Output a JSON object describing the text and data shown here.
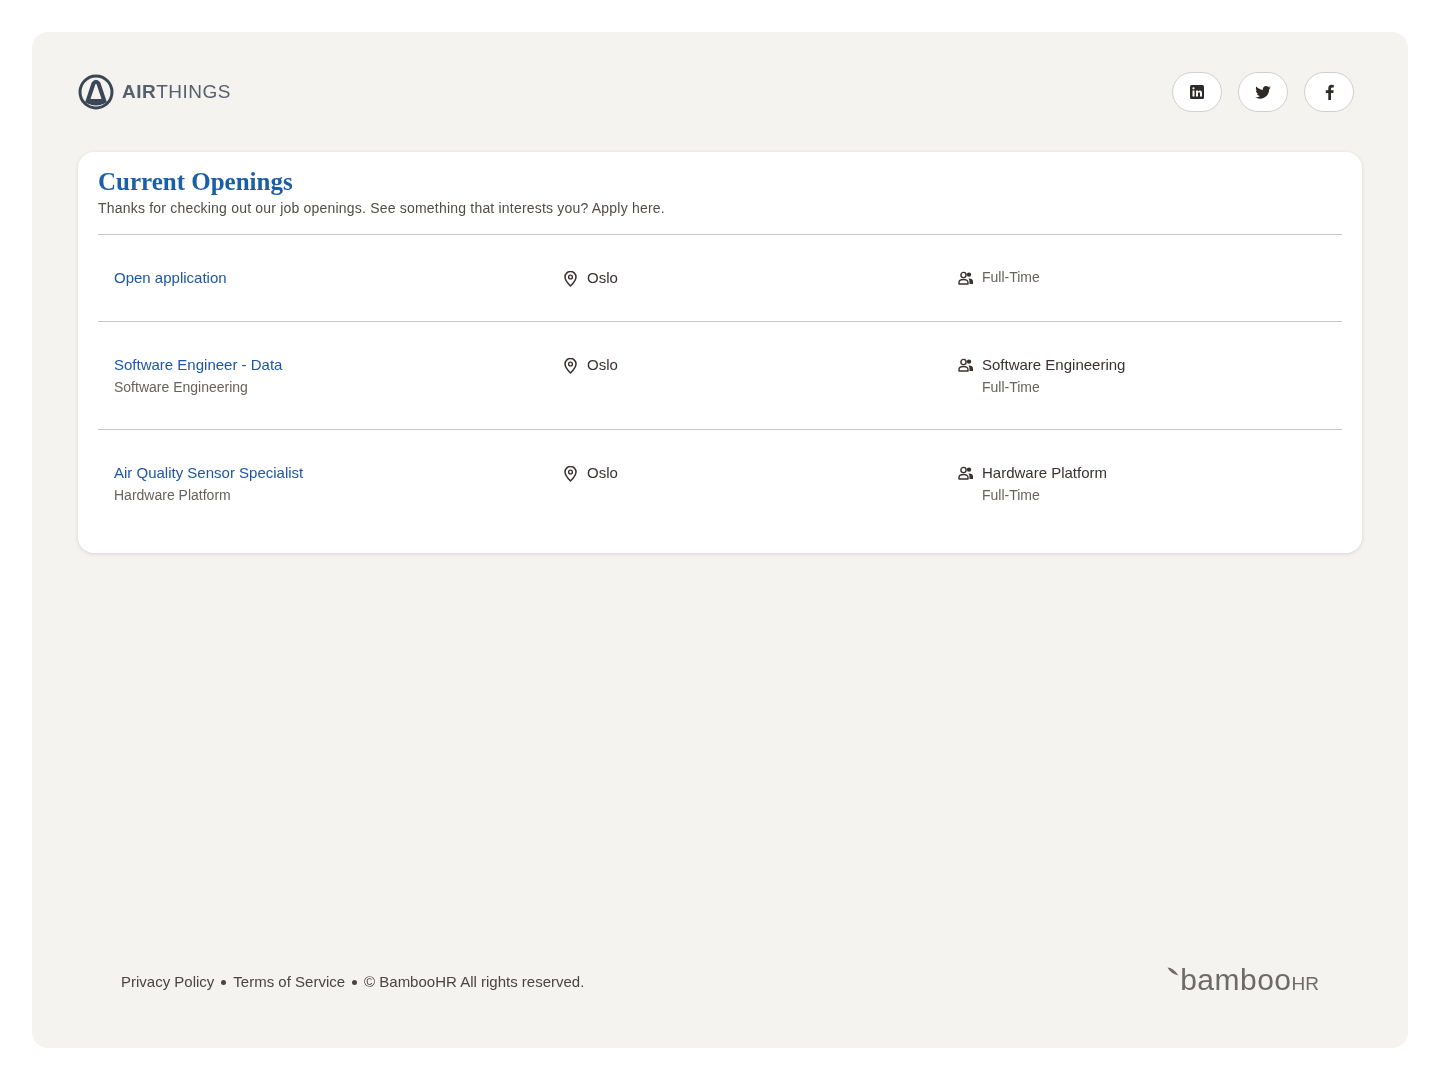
{
  "header": {
    "logo": {
      "text": "**AIR**THINGS"
    },
    "social_links": [
      {
        "kind": "linkedin"
      },
      {
        "kind": "twitter"
      },
      {
        "kind": "facebook"
      }
    ]
  },
  "openings": {
    "title": "Current Openings",
    "intro": "Thanks for checking out our job openings. See something that interests you? Apply here.",
    "jobs": [
      {
        "title": "Open application",
        "location": "Oslo",
        "employment_type": "Full-Time"
      },
      {
        "title": "Software Engineer - Data",
        "department": "Software Engineering",
        "location": "Oslo",
        "team": "Software Engineering",
        "employment_type": "Full-Time"
      },
      {
        "title": "Air Quality Sensor Specialist",
        "department": "Hardware Platform",
        "location": "Oslo",
        "team": "Hardware Platform",
        "employment_type": "Full-Time"
      }
    ]
  },
  "footer": {
    "links": [
      "Privacy Policy",
      "Terms of Service"
    ],
    "copyright": "© BambooHR All rights reserved.",
    "brand": {
      "name": "bamboo",
      "suffix": "HR"
    }
  }
}
